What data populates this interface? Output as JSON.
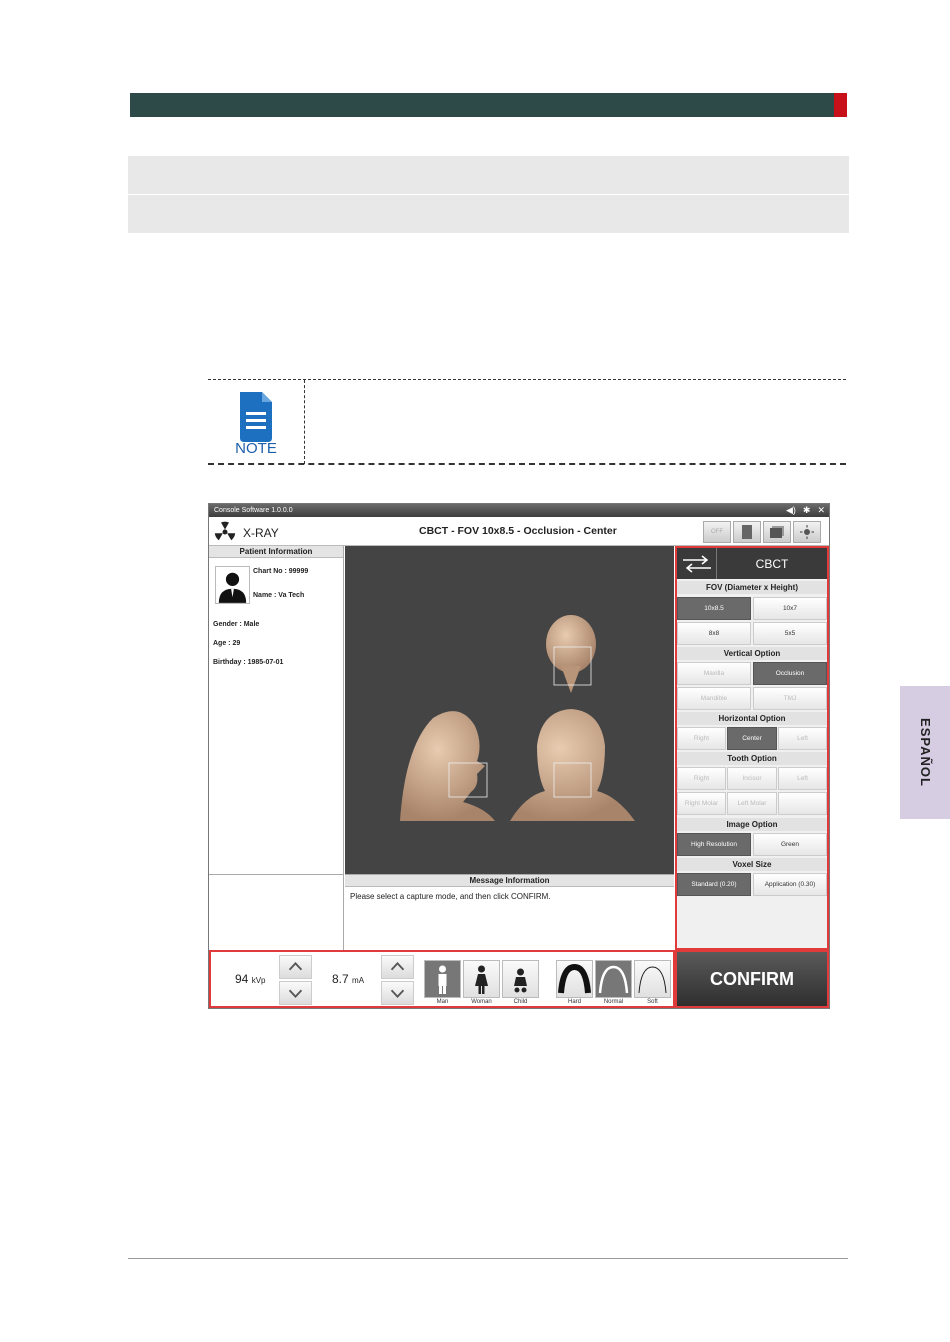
{
  "page": {
    "side_tab": "ESPAÑOL",
    "note_label": "NOTE"
  },
  "console": {
    "title": "Console Software  1.0.0.0",
    "app_name": "X-RAY",
    "header_title": "CBCT - FOV 10x8.5 - Occlusion - Center",
    "header_icons": [
      "radiation-icon",
      "volume-icon",
      "settings-icon",
      "close-icon",
      "off-icon",
      "device-icon",
      "screen-icon",
      "light-icon"
    ],
    "off_label": "OFF",
    "patient": {
      "section": "Patient Information",
      "chart_no": "Chart No : 99999",
      "name": "Name : Va Tech",
      "gender": "Gender : Male",
      "age": "Age : 29",
      "birthday": "Birthday : 1985-07-01"
    },
    "message": {
      "section": "Message Information",
      "text": "Please select a capture mode, and then click CONFIRM."
    },
    "right_panel": {
      "mode": "CBCT",
      "fov": {
        "label": "FOV (Diameter x Height)",
        "options": [
          "10x8.5",
          "10x7",
          "8x8",
          "5x5"
        ],
        "selected": "10x8.5"
      },
      "vertical": {
        "label": "Vertical Option",
        "options": [
          "Maxilla",
          "Occlusion",
          "Mandible",
          "TMJ"
        ],
        "selected": "Occlusion"
      },
      "horizontal": {
        "label": "Horizontal Option",
        "options": [
          "Right",
          "Center",
          "Left"
        ],
        "selected": "Center"
      },
      "tooth": {
        "label": "Tooth Option",
        "options": [
          "Right",
          "Incisor",
          "Left",
          "Right Molar",
          "Left Molar"
        ]
      },
      "image": {
        "label": "Image Option",
        "options": [
          "High Resolution",
          "Green"
        ],
        "selected": "High Resolution"
      },
      "voxel": {
        "label": "Voxel Size",
        "options": [
          "Standard   (0.20)",
          "Application (0.30)"
        ],
        "selected": "Standard   (0.20)"
      }
    },
    "bottom": {
      "kvp_value": "94",
      "kvp_unit": "kVp",
      "ma_value": "8.7",
      "ma_unit": "mA",
      "patient_types": [
        "Man",
        "Woman",
        "Child"
      ],
      "patient_selected": "Man",
      "arch_types": [
        "Hard",
        "Normal",
        "Soft"
      ],
      "arch_selected": "Normal"
    },
    "confirm": "CONFIRM"
  }
}
